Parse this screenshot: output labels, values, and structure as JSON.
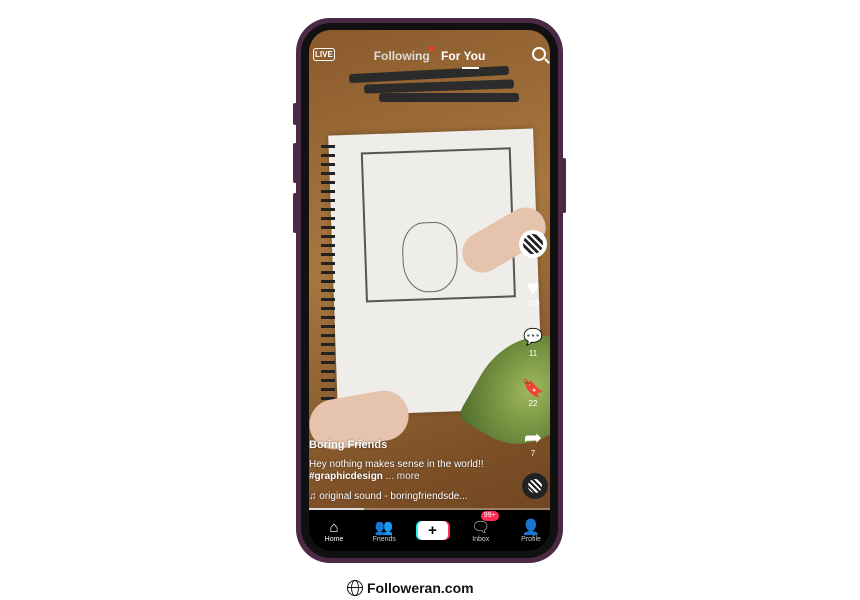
{
  "header": {
    "live_label": "LIVE",
    "tabs": [
      {
        "label": "Following",
        "has_notification": true
      },
      {
        "label": "For You",
        "active": true
      }
    ]
  },
  "video": {
    "username": "Boring Friends",
    "caption": "Hey nothing makes sense in the world!! ",
    "hashtag": "#graphicdesign",
    "more_label": "... more",
    "sound": "original sound - boringfriendsde...",
    "progress_percent": 23
  },
  "actions": {
    "likes": "409",
    "comments": "11",
    "saves": "22",
    "shares": "7"
  },
  "nav": {
    "items": [
      {
        "label": "Home",
        "icon": "home-icon"
      },
      {
        "label": "Friends",
        "icon": "friends-icon"
      },
      {
        "label": "+",
        "icon": "create-icon"
      },
      {
        "label": "Inbox",
        "icon": "inbox-icon",
        "badge": "99+"
      },
      {
        "label": "Profile",
        "icon": "profile-icon"
      }
    ]
  },
  "watermark": {
    "text": "Followeran.com"
  },
  "colors": {
    "frame": "#4a2a45",
    "accent_red": "#fe2c55",
    "accent_cyan": "#25f4ee"
  }
}
